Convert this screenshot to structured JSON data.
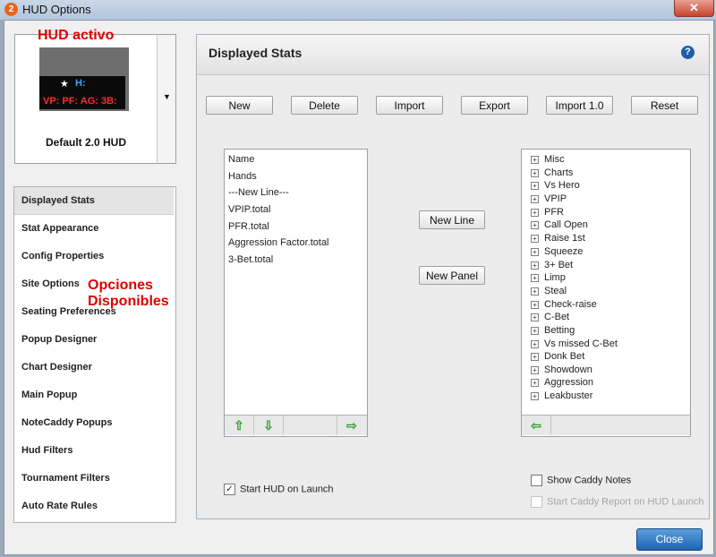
{
  "window": {
    "title": "HUD Options",
    "close_glyph": "✕",
    "app_icon": "2"
  },
  "annotations": {
    "hud_active": "HUD activo",
    "options_line1": "Opciones",
    "options_line2": "Disponibles"
  },
  "hud": {
    "name": "Default 2.0 HUD",
    "preview_h": "H:",
    "preview_stats": "VP: PF: AG: 3B:",
    "star_glyph": "★",
    "badge": "+",
    "dropdown_icon": "▼"
  },
  "nav": {
    "items": [
      "Displayed Stats",
      "Stat Appearance",
      "Config Properties",
      "Site Options",
      "Seating Preferences",
      "Popup Designer",
      "Chart Designer",
      "Main Popup",
      "NoteCaddy Popups",
      "Hud Filters",
      "Tournament Filters",
      "Auto Rate Rules"
    ],
    "active": "Displayed Stats"
  },
  "panel": {
    "title": "Displayed Stats",
    "help_glyph": "?",
    "toolbar": [
      "New",
      "Delete",
      "Import",
      "Export",
      "Import 1.0",
      "Reset"
    ],
    "selected_stats": [
      "Name",
      "Hands",
      "---New Line---",
      "VPIP.total",
      "PFR.total",
      "Aggression Factor.total",
      "3-Bet.total"
    ],
    "new_line_label": "New Line",
    "new_panel_label": "New Panel",
    "categories": [
      "Misc",
      "Charts",
      "Vs Hero",
      "VPIP",
      "PFR",
      "Call Open",
      "Raise 1st",
      "Squeeze",
      "3+ Bet",
      "Limp",
      "Steal",
      "Check-raise",
      "C-Bet",
      "Betting",
      "Vs missed C-Bet",
      "Donk Bet",
      "Showdown",
      "Aggression",
      "Leakbuster"
    ],
    "arrows": {
      "up": "⇧",
      "down": "⇩",
      "right": "⇨",
      "left": "⇦"
    },
    "start_hud_label": "Start HUD on Launch",
    "start_hud_checked": true,
    "show_caddy_label": "Show Caddy Notes",
    "show_caddy_checked": false,
    "start_caddy_label": "Start Caddy Report on HUD Launch",
    "start_caddy_enabled": false,
    "check_glyph": "✓"
  },
  "footer": {
    "close_label": "Close"
  },
  "colors": {
    "accent": "#1f64b2",
    "annotation": "#e00000",
    "arrow": "#2ea22e"
  }
}
